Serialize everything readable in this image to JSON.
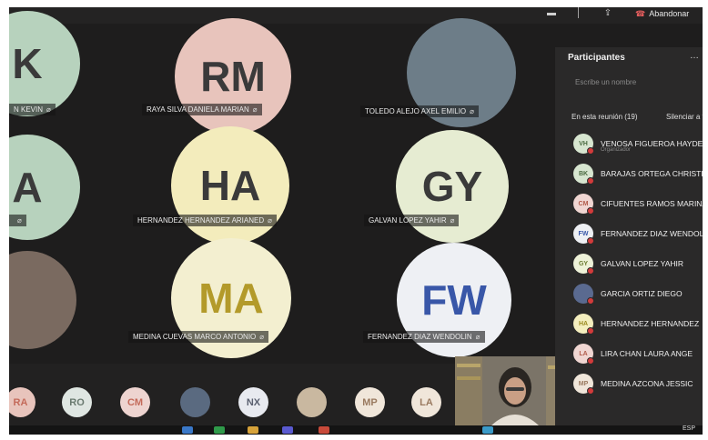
{
  "toolbar": {
    "leave_label": "Abandonar"
  },
  "tiles": [
    {
      "initials": "K",
      "name": "N KEVIN",
      "bg": "#b7d2bd",
      "fg": "#3a3a3a"
    },
    {
      "initials": "RM",
      "name": "RAYA SILVA DANIELA MARIAN",
      "bg": "#e8c4bc",
      "fg": "#3a3a3a"
    },
    {
      "initials": "",
      "name": "TOLEDO ALEJO AXEL EMILIO",
      "bg": "#6d7d88",
      "fg": "#3a3a3a"
    },
    {
      "initials": "A",
      "name": "",
      "bg": "#b7d2bd",
      "fg": "#3a3a3a"
    },
    {
      "initials": "HA",
      "name": "HERNANDEZ HERNANDEZ ARIANED",
      "bg": "#f3ecbc",
      "fg": "#3a3a3a"
    },
    {
      "initials": "GY",
      "name": "GALVAN LOPEZ YAHIR",
      "bg": "#e6ecd2",
      "fg": "#3a3a3a"
    },
    {
      "initials": "",
      "name": "",
      "bg": "#7a6a60",
      "fg": "#3a3a3a"
    },
    {
      "initials": "MA",
      "name": "MEDINA CUEVAS MARCO ANTONIO",
      "bg": "#f3efd0",
      "fg": "#b39a2a"
    },
    {
      "initials": "FW",
      "name": "FERNANDEZ DIAZ WENDOLIN",
      "bg": "#eef0f4",
      "fg": "#3957a8"
    }
  ],
  "strip": [
    {
      "initials": "RA",
      "bg": "#e8c4bc",
      "fg": "#c46a5a"
    },
    {
      "initials": "RO",
      "bg": "#dfe6e2",
      "fg": "#6a7a70"
    },
    {
      "initials": "CM",
      "bg": "#eed4d0",
      "fg": "#c46a5a"
    },
    {
      "initials": "",
      "bg": "#5a6a80",
      "fg": "#3a3a3a"
    },
    {
      "initials": "NX",
      "bg": "#e8eaf0",
      "fg": "#5a6070"
    },
    {
      "initials": "",
      "bg": "#c9b8a0",
      "fg": "#3a3a3a"
    },
    {
      "initials": "MP",
      "bg": "#f0e6da",
      "fg": "#9a7a60"
    },
    {
      "initials": "LA",
      "bg": "#f0e6da",
      "fg": "#9a7a60"
    }
  ],
  "panel": {
    "title": "Participantes",
    "search_placeholder": "Escribe un nombre",
    "in_meeting": "En esta reunión (19)",
    "mute_all": "Silenciar a to",
    "organizer_role": "Organizador",
    "participants": [
      {
        "initials": "VH",
        "name": "VENOSA FIGUEROA HAYDEE",
        "bg": "#d7e6d0",
        "fg": "#4a6a40"
      },
      {
        "initials": "BK",
        "name": "BARAJAS ORTEGA CHRISTIAN",
        "bg": "#d7e6d0",
        "fg": "#4a6a40"
      },
      {
        "initials": "CM",
        "name": "CIFUENTES RAMOS MARINA",
        "bg": "#f0d6d2",
        "fg": "#b05a4a"
      },
      {
        "initials": "FW",
        "name": "FERNANDEZ DIAZ WENDOLI",
        "bg": "#eef0f4",
        "fg": "#3957a8"
      },
      {
        "initials": "GY",
        "name": "GALVAN LOPEZ YAHIR",
        "bg": "#eef2d8",
        "fg": "#6a7a30"
      },
      {
        "initials": "",
        "name": "GARCIA ORTIZ DIEGO",
        "bg": "#5a6a90",
        "fg": "#ffffff"
      },
      {
        "initials": "HA",
        "name": "HERNANDEZ HERNANDEZ",
        "bg": "#f4eebe",
        "fg": "#9a8a20"
      },
      {
        "initials": "LA",
        "name": "LIRA CHAN LAURA ANGE",
        "bg": "#f0d6d2",
        "fg": "#b05a4a"
      },
      {
        "initials": "MP",
        "name": "MEDINA AZCONA JESSIC",
        "bg": "#f0e6da",
        "fg": "#9a7a60"
      }
    ]
  },
  "taskbar": {
    "lang": "ESP"
  }
}
